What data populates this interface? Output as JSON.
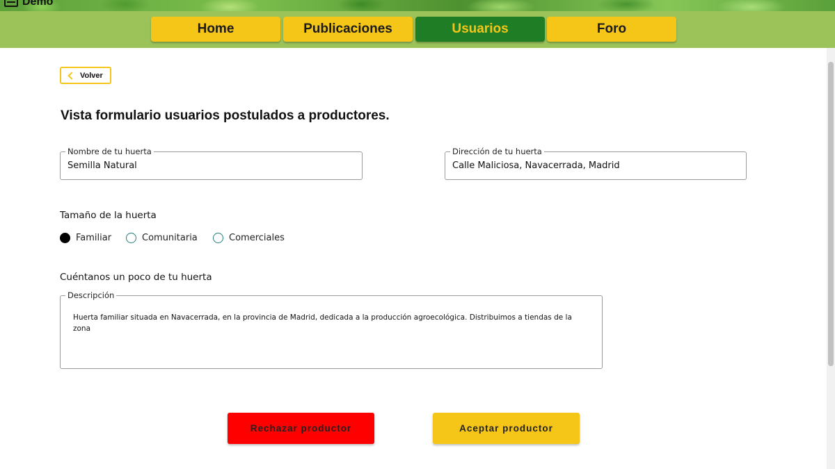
{
  "app": {
    "brand": "Demo"
  },
  "nav": {
    "items": [
      {
        "label": "Home",
        "active": false
      },
      {
        "label": "Publicaciones",
        "active": false
      },
      {
        "label": "Usuarios",
        "active": true
      },
      {
        "label": "Foro",
        "active": false
      }
    ]
  },
  "back": {
    "label": "Volver"
  },
  "page": {
    "title": "Vista formulario usuarios postulados a productores."
  },
  "form": {
    "garden_name": {
      "legend": "Nombre de tu huerta",
      "value": "Semilla Natural"
    },
    "garden_address": {
      "legend": "Dirección de tu huerta",
      "value": "Calle Maliciosa, Navacerrada, Madrid"
    },
    "size": {
      "label": "Tamaño de la huerta",
      "options": [
        {
          "label": "Familiar",
          "checked": true
        },
        {
          "label": "Comunitaria",
          "checked": false
        },
        {
          "label": "Comerciales",
          "checked": false
        }
      ]
    },
    "about": {
      "label": "Cuéntanos un poco de tu huerta",
      "legend": "Descripción",
      "value": "Huerta familiar situada en Navacerrada, en la provincia de Madrid, dedicada a la producción agroecológica. Distribuimos a tiendas de la zona"
    }
  },
  "actions": {
    "reject_label": "Rechazar productor",
    "accept_label": "Aceptar productor"
  },
  "colors": {
    "accent_yellow": "#f5c518",
    "active_green": "#1f7d25",
    "nav_green": "#9bc35a",
    "reject_red": "#ff0000"
  }
}
